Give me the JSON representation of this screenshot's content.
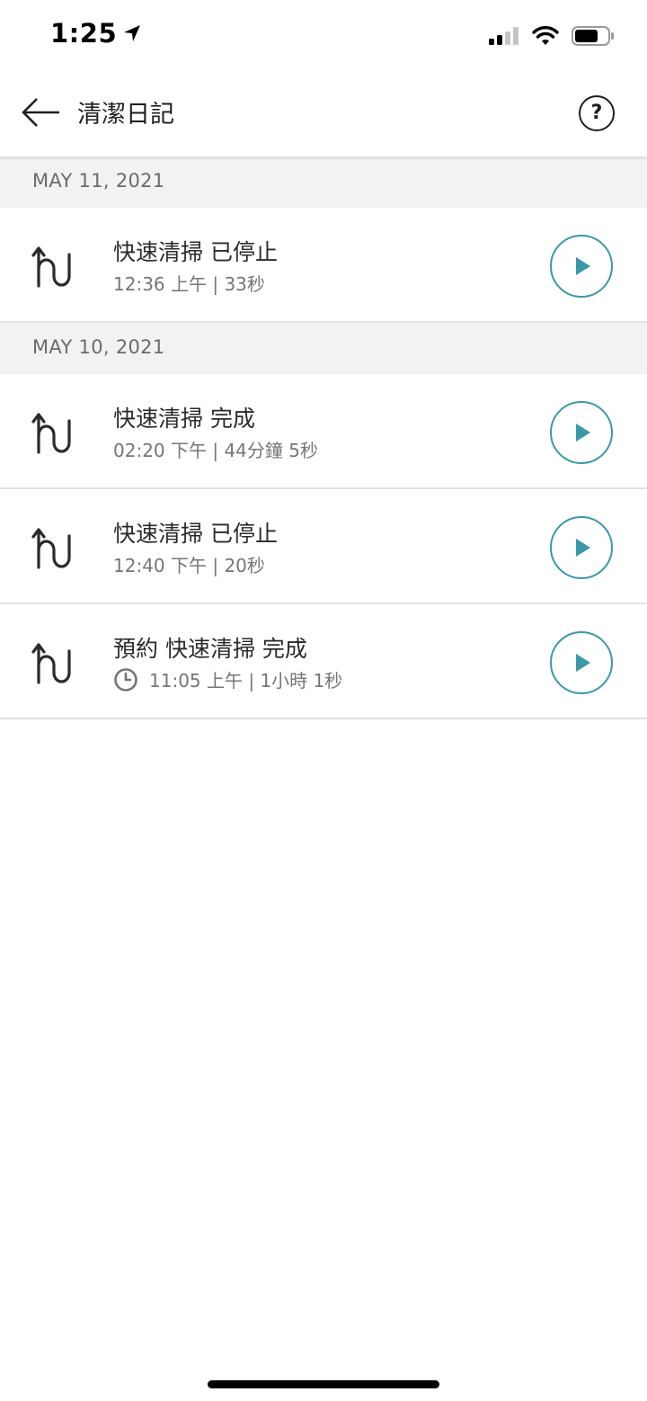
{
  "status_bar": {
    "time": "1:25",
    "icons": [
      "location-arrow-icon",
      "cellular-signal-icon",
      "wifi-icon",
      "battery-icon"
    ]
  },
  "header": {
    "title": "清潔日記",
    "back_icon": "arrow-left-icon",
    "help_label": "?"
  },
  "groups": [
    {
      "date": "MAY 11, 2021",
      "entries": [
        {
          "title": "快速清掃 已停止",
          "detail": "12:36 上午 | 33秒",
          "scheduled": false
        }
      ]
    },
    {
      "date": "MAY 10, 2021",
      "entries": [
        {
          "title": "快速清掃 完成",
          "detail": "02:20 下午 | 44分鐘 5秒",
          "scheduled": false
        },
        {
          "title": "快速清掃 已停止",
          "detail": "12:40 下午 | 20秒",
          "scheduled": false
        },
        {
          "title": "預約 快速清掃 完成",
          "detail": "11:05 上午 | 1小時 1秒",
          "scheduled": true
        }
      ]
    }
  ],
  "colors": {
    "accent": "#3a98aa",
    "date_header_bg": "#f2f2f2",
    "divider": "#e3e3e3"
  }
}
